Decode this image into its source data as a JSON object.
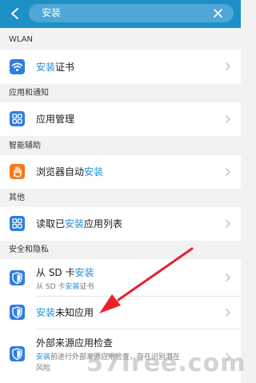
{
  "search": {
    "query": "安装"
  },
  "sections": {
    "wlan": "WLAN",
    "apps_notifications": "应用和通知",
    "smart_assist": "智能辅助",
    "other": "其他",
    "security_privacy": "安全和隐私"
  },
  "rows": {
    "install_cert": {
      "title_hl": "安装",
      "title_rest": "证书"
    },
    "app_management": {
      "title": "应用管理"
    },
    "browser_auto_install": {
      "title_pre": "浏览器自动",
      "title_hl": "安装"
    },
    "read_installed_apps": {
      "title_pre": "读取已",
      "title_hl": "安装",
      "title_post": "应用列表"
    },
    "install_from_sd": {
      "title_pre": "从 SD 卡",
      "title_hl": "安装",
      "sub_pre": "从 SD 卡",
      "sub_hl": "安装",
      "sub_post": "证书"
    },
    "install_unknown": {
      "title_hl": "安装",
      "title_rest": "未知应用"
    },
    "external_source_check": {
      "title": "外部来源应用检查",
      "sub_hl": "安装",
      "sub_post": "前进行外部来源应用检查，存在识别潜在",
      "sub_line2": "风险"
    }
  },
  "watermark": "57Iree.com",
  "colors": {
    "header": "#1e90c8",
    "highlight": "#1e8fd6",
    "arrow": "#e8212b",
    "icon_blue": "#2f7de1",
    "icon_orange": "#f47a20"
  },
  "icons": {
    "back": "arrow-left-icon",
    "clear": "close-icon",
    "wifi": "wifi-icon",
    "apps": "grid-icon",
    "hand": "hand-icon",
    "shield": "shield-icon",
    "chevron": "chevron-right-icon"
  }
}
